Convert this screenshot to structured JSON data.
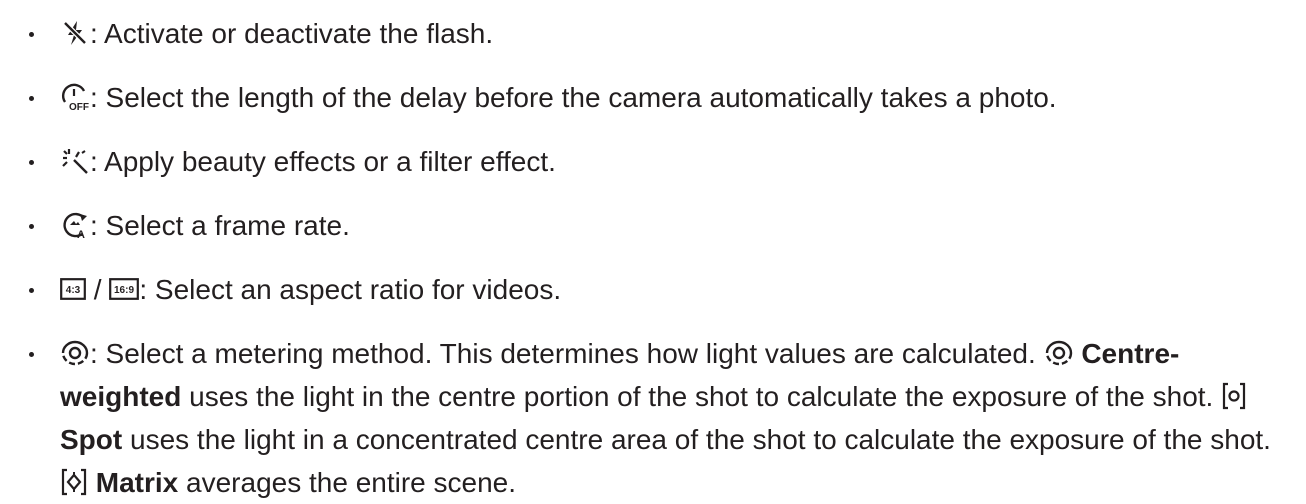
{
  "items": [
    {
      "icon": "flash-off-icon",
      "text": ": Activate or deactivate the flash."
    },
    {
      "icon": "timer-off-icon",
      "text": ": Select the length of the delay before the camera automatically takes a photo."
    },
    {
      "icon": "beauty-filter-icon",
      "text": ": Apply beauty effects or a filter effect."
    },
    {
      "icon": "frame-rate-auto-icon",
      "text": ": Select a frame rate."
    },
    {
      "icon_a": "ratio-4-3-icon",
      "ratio_a": "4:3",
      "separator": "/",
      "icon_b": "ratio-16-9-icon",
      "ratio_b": "16:9",
      "text": ": Select an aspect ratio for videos."
    },
    {
      "icon": "metering-centre-weighted-icon",
      "text_1": ": Select a metering method. This determines how light values are calculated.",
      "centre_label": "Centre-weighted",
      "centre_text": "uses the light in the centre portion of the shot to calculate the exposure of the shot.",
      "spot_icon": "metering-spot-icon",
      "spot_label": "Spot",
      "spot_text": "uses the light in a concentrated centre area of the shot to calculate the exposure of the shot.",
      "matrix_icon": "metering-matrix-icon",
      "matrix_label": "Matrix",
      "matrix_text": "averages the entire scene."
    }
  ]
}
